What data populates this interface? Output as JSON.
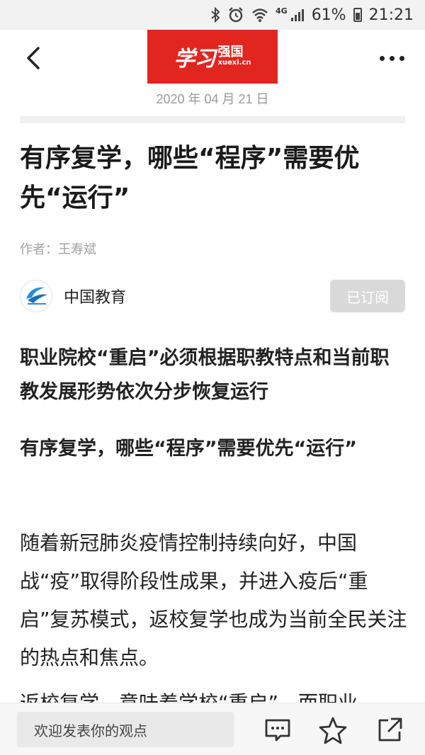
{
  "status_bar": {
    "network": "4G",
    "battery": "61%",
    "time": "21:21"
  },
  "header": {
    "logo_main": "学习",
    "logo_side_top": "强国",
    "logo_side_bottom": "xuexi.cn",
    "date": "2020 年 04 月 21 日"
  },
  "article": {
    "title": "有序复学，哪些“程序”需要优先“运行”",
    "author": "作者：王寿斌",
    "source_name": "中国教育",
    "subscribe_label": "已订阅",
    "subtitle_1": "职业院校“重启”必须根据职教特点和当前职教发展形势依次分步恢复运行",
    "subtitle_2": "有序复学，哪些“程序”需要优先“运行”",
    "paragraph_1": "随着新冠肺炎疫情控制持续向好，中国战“疫”取得阶段性成果，并进入疫后“重启”复苏模式，返校复学也成为当前全民关注的热点和焦点。",
    "paragraph_2": "返校复学，意味着学校“重启”，而职业"
  },
  "bottom_bar": {
    "comment_placeholder": "欢迎发表你的观点"
  }
}
